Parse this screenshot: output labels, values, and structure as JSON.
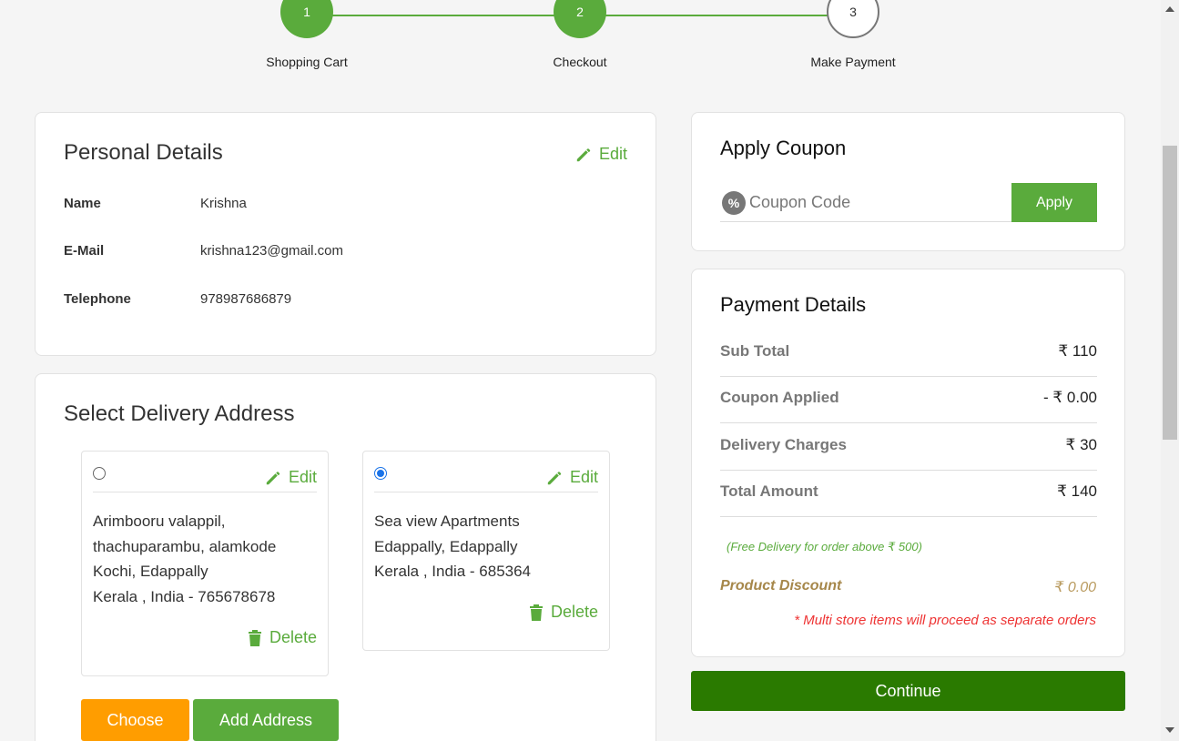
{
  "stepper": {
    "steps": [
      {
        "number": "1",
        "label": "Shopping Cart",
        "state": "done"
      },
      {
        "number": "2",
        "label": "Checkout",
        "state": "done"
      },
      {
        "number": "3",
        "label": "Make Payment",
        "state": "todo"
      }
    ]
  },
  "personal": {
    "title": "Personal Details",
    "edit_label": "Edit",
    "fields": [
      {
        "label": "Name",
        "value": "Krishna"
      },
      {
        "label": "E-Mail",
        "value": "krishna123@gmail.com"
      },
      {
        "label": "Telephone",
        "value": "978987686879"
      }
    ]
  },
  "delivery": {
    "title": "Select Delivery Address",
    "addresses": [
      {
        "selected": false,
        "edit_label": "Edit",
        "delete_label": "Delete",
        "lines": [
          "Arimbooru valappil,",
          "thachuparambu, alamkode",
          "Kochi, Edappally",
          "Kerala , India - 765678678"
        ]
      },
      {
        "selected": true,
        "edit_label": "Edit",
        "delete_label": "Delete",
        "lines": [
          "Sea view Apartments",
          "Edappally, Edappally",
          "Kerala , India - 685364"
        ]
      }
    ],
    "choose_label": "Choose",
    "add_label": "Add Address"
  },
  "coupon": {
    "title": "Apply Coupon",
    "placeholder": "Coupon Code",
    "value": "",
    "apply_label": "Apply",
    "icon": "percent-badge-icon"
  },
  "payment": {
    "title": "Payment Details",
    "rows": [
      {
        "label": "Sub Total",
        "value": "₹ 110"
      },
      {
        "label": "Coupon Applied",
        "value": "- ₹ 0.00"
      },
      {
        "label": "Delivery Charges",
        "value": "₹ 30"
      },
      {
        "label": "Total Amount",
        "value": "₹ 140"
      }
    ],
    "free_note": "(Free Delivery for order above ₹ 500)",
    "discount_label": "Product Discount",
    "discount_value": "₹ 0.00",
    "multi_store_note": "* Multi store items will proceed as separate orders"
  },
  "continue_label": "Continue",
  "colors": {
    "accent_green": "#5aab3c",
    "dark_green": "#2a7a00",
    "orange": "#ff9d00",
    "error_red": "#e33",
    "radio_blue": "#1a73e8"
  }
}
